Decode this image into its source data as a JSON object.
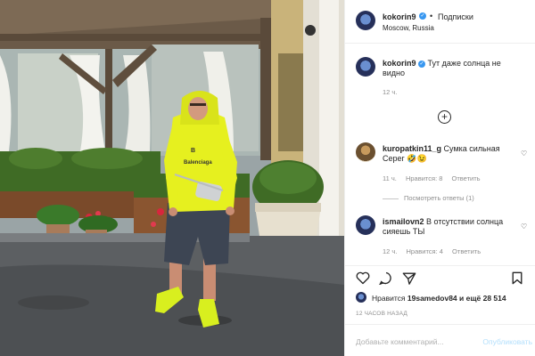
{
  "post": {
    "username": "kokorin9",
    "follow_label": "Подписки",
    "location": "Moscow, Russia",
    "caption": "Тут даже солнца не видно",
    "caption_time": "12 ч.",
    "photo_alt": "Man in neon yellow hoodie standing outside a restaurant terrace",
    "hoodie_text": "Balenciaga"
  },
  "comments": [
    {
      "username": "kuropatkin11_g",
      "text": "Сумка сильная Серег 🤣😉",
      "time": "11 ч.",
      "likes": "Нравится: 8",
      "reply": "Ответить",
      "view_replies": "Посмотреть ответы (1)"
    },
    {
      "username": "ismailovn2",
      "text": "В отсутствии солнца сияешь ТЫ",
      "time": "12 ч.",
      "likes": "Нравится: 4",
      "reply": "Ответить"
    }
  ],
  "likes_line": {
    "prefix": "Нравится",
    "user": "19samedov84",
    "suffix": "и ещё 28 514"
  },
  "post_time": "12 ЧАСОВ НАЗАД",
  "comment_input": {
    "placeholder": "Добавьте комментарий...",
    "publish": "Опубликовать"
  },
  "colors": {
    "verified": "#3897f0",
    "hoodie": "#e6f01f",
    "shorts": "#3d4553",
    "hedge": "#3f6b25"
  },
  "icons": [
    "heart-icon",
    "comment-icon",
    "share-icon",
    "bookmark-icon",
    "plus-circle-icon",
    "verified-badge-icon"
  ]
}
